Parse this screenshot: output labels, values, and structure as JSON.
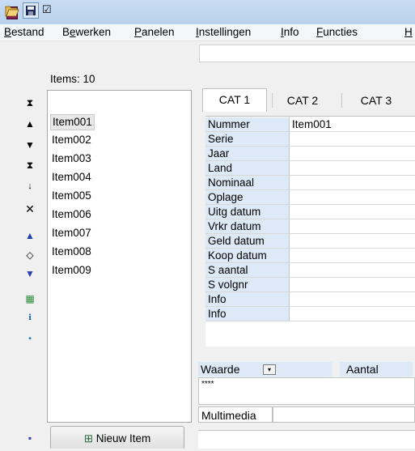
{
  "window": {
    "title": "[ ]"
  },
  "menu": [
    {
      "accel": "B",
      "rest": "estand"
    },
    {
      "pre": "B",
      "accel": "e",
      "rest": "werken"
    },
    {
      "accel": "P",
      "rest": "anelen"
    },
    {
      "accel": "I",
      "rest": "nstellingen"
    },
    {
      "accel": "I",
      "rest": "nfo"
    },
    {
      "accel": "F",
      "rest": "uncties"
    },
    {
      "accel": "H",
      "rest": ""
    }
  ],
  "list": {
    "count_label": "Items: 10",
    "items": [
      "Item001",
      "Item002",
      "Item003",
      "Item004",
      "Item005",
      "Item006",
      "Item007",
      "Item008",
      "Item009"
    ],
    "selected_index": 0,
    "new_button_label": "Nieuw Item"
  },
  "tabs": [
    "CAT 1",
    "CAT 2",
    "CAT 3"
  ],
  "fields": [
    {
      "label": "Nummer",
      "value": "Item001"
    },
    {
      "label": "Serie",
      "value": ""
    },
    {
      "label": "Jaar",
      "value": ""
    },
    {
      "label": "Land",
      "value": ""
    },
    {
      "label": "Nominaal",
      "value": ""
    },
    {
      "label": "Oplage",
      "value": ""
    },
    {
      "label": "Uitg datum",
      "value": ""
    },
    {
      "label": "Vrkr datum",
      "value": ""
    },
    {
      "label": "Geld datum",
      "value": ""
    },
    {
      "label": "Koop datum",
      "value": ""
    },
    {
      "label": "S aantal",
      "value": ""
    },
    {
      "label": "S volgnr",
      "value": ""
    },
    {
      "label": "Info",
      "value": ""
    },
    {
      "label": "Info",
      "value": ""
    }
  ],
  "lower": {
    "waarde_label": "Waarde",
    "aantal_label": "Aantal",
    "stars": "****",
    "multimedia_label": "Multimedia"
  },
  "colors": {
    "title_bar": "#c9dcf2",
    "label_bg": "#dde9f6",
    "app_icon": "#8b1a5a"
  },
  "icons": [
    "folder-open-icon",
    "save-icon",
    "check-icon",
    "move-top-icon",
    "move-up-icon",
    "move-down-icon",
    "move-bottom-icon",
    "sort-icon",
    "delete-icon",
    "blue-shape-icon",
    "diamond-icon",
    "bookmark-icon",
    "grid-icon",
    "tree-icon",
    "list-icon"
  ]
}
